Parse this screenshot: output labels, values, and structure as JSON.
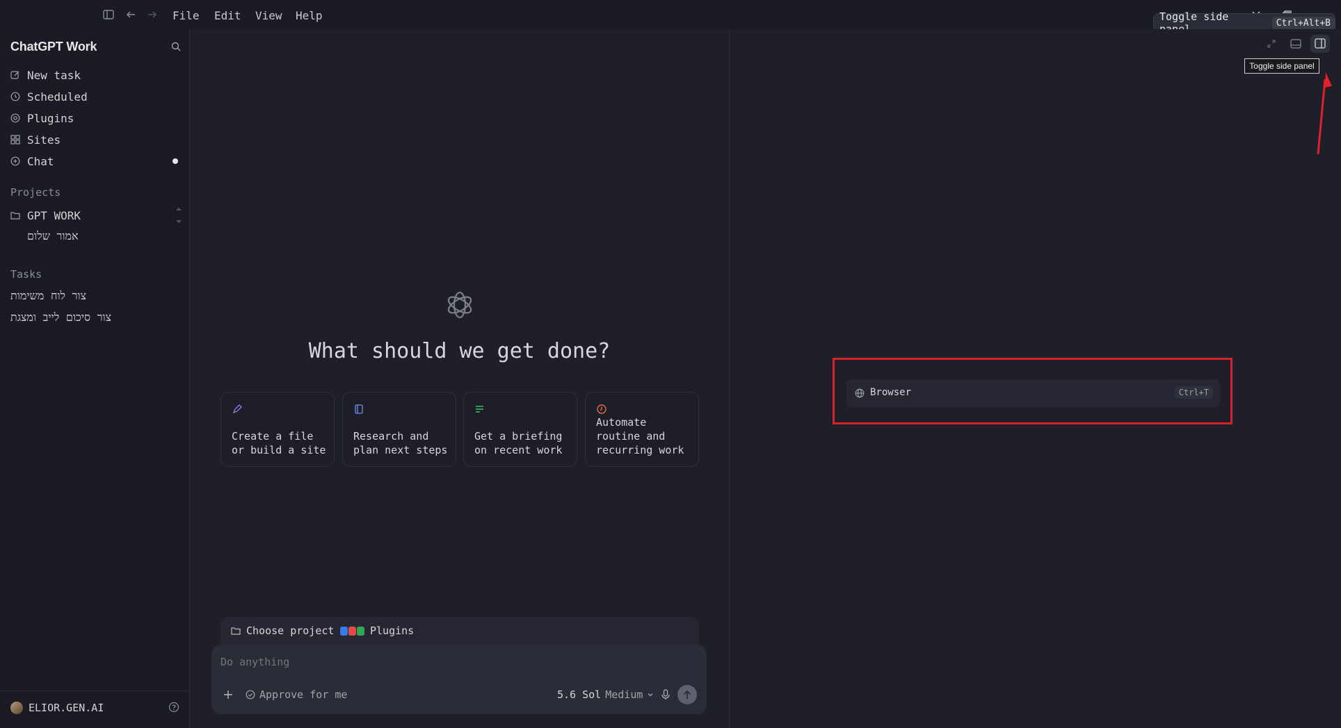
{
  "titlebar": {
    "menus": [
      "File",
      "Edit",
      "View",
      "Help"
    ],
    "tooltip_label": "Toggle side panel",
    "tooltip_shortcut": "Ctrl+Alt+B"
  },
  "sidebar": {
    "app_title": "ChatGPT Work",
    "nav": [
      {
        "label": "New task",
        "icon": "edit-icon"
      },
      {
        "label": "Scheduled",
        "icon": "clock-icon"
      },
      {
        "label": "Plugins",
        "icon": "plugin-icon"
      },
      {
        "label": "Sites",
        "icon": "grid-icon"
      },
      {
        "label": "Chat",
        "icon": "chat-icon"
      }
    ],
    "projects_label": "Projects",
    "project_name": "GPT WORK",
    "project_subitem": "אמור שלום",
    "tasks_label": "Tasks",
    "tasks": [
      "צור לוח משימות",
      "צור סיכום לייב ומצגת"
    ],
    "user_name": "ELIOR.GEN.AI"
  },
  "main": {
    "heading": "What should we get done?",
    "cards": [
      {
        "text": "Create a file\nor build a site",
        "icon": "pen-icon",
        "color": "#9a7cf0"
      },
      {
        "text": "Research and\nplan next steps",
        "icon": "book-icon",
        "color": "#6e8ff0"
      },
      {
        "text": "Get a briefing\non recent work",
        "icon": "list-icon",
        "color": "#3fbf6a"
      },
      {
        "text": "Automate\nroutine and\nrecurring work",
        "icon": "clock-icon",
        "color": "#f06a3c"
      }
    ],
    "choose_project": "Choose project",
    "plugins_label": "Plugins",
    "input_placeholder": "Do anything",
    "approve_label": "Approve for me",
    "model_label": "5.6 Sol",
    "effort_label": "Medium"
  },
  "right_panel": {
    "tooltip": "Toggle side panel",
    "browser_label": "Browser",
    "browser_shortcut": "Ctrl+T"
  },
  "colors": {
    "background": "#1e1f29",
    "sidebar": "#1b1c23",
    "highlight_box": "#d8202a",
    "arrow": "#e3202b"
  }
}
